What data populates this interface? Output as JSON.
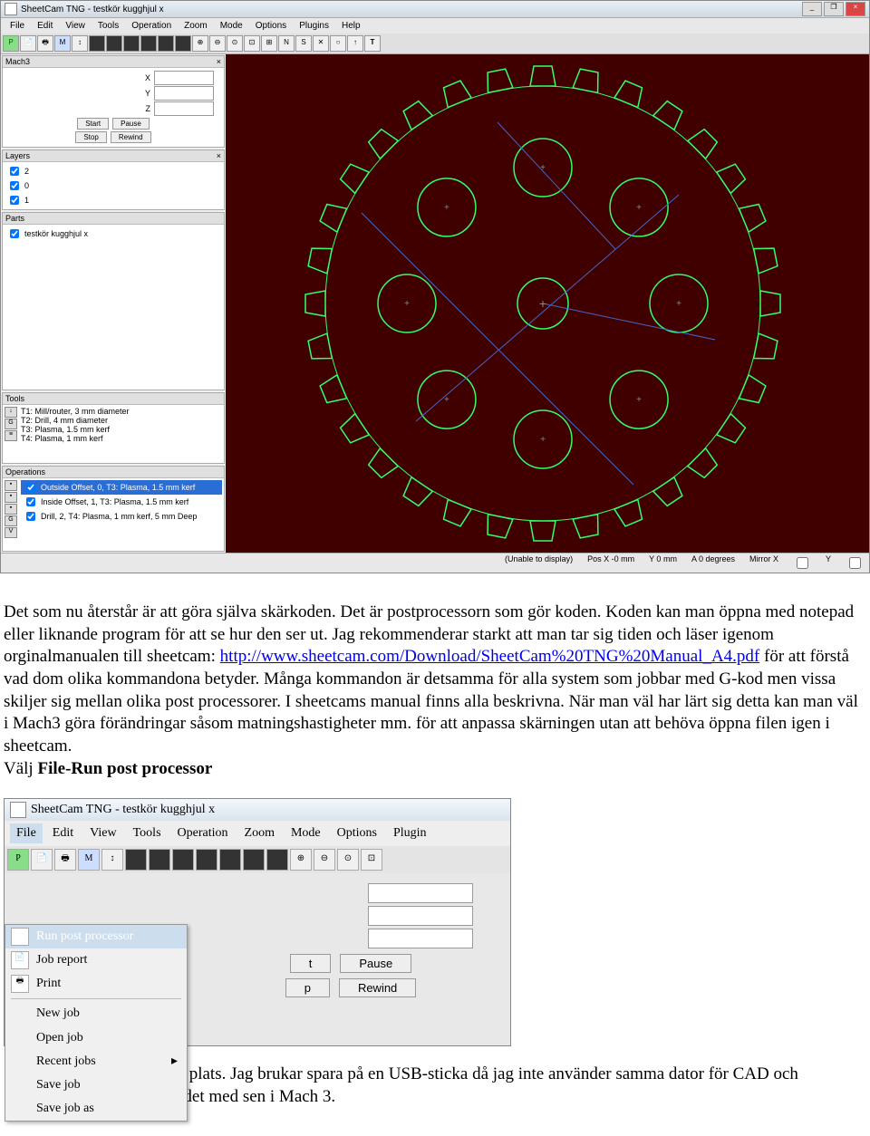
{
  "app": {
    "title": "SheetCam TNG - testkör kugghjul x",
    "menus": [
      "File",
      "Edit",
      "View",
      "Tools",
      "Operation",
      "Zoom",
      "Mode",
      "Options",
      "Plugins",
      "Help"
    ],
    "mach_panel": {
      "title": "Mach3",
      "axes": [
        "X",
        "Y",
        "Z"
      ],
      "buttons": [
        "Start",
        "Pause",
        "Stop",
        "Rewind"
      ]
    },
    "layers": {
      "title": "Layers",
      "close": "×",
      "items": [
        "2",
        "0",
        "1"
      ]
    },
    "parts": {
      "title": "Parts",
      "items": [
        "testkör kugghjul x"
      ]
    },
    "tools": {
      "title": "Tools",
      "items": [
        "T1: Mill/router, 3 mm diameter",
        "T2: Drill, 4 mm diameter",
        "T3: Plasma, 1.5 mm kerf",
        "T4: Plasma, 1 mm kerf"
      ]
    },
    "operations": {
      "title": "Operations",
      "items": [
        "Outside Offset, 0, T3: Plasma, 1.5 mm kerf",
        "Inside Offset, 1, T3: Plasma, 1.5 mm kerf",
        "Drill, 2, T4: Plasma, 1 mm kerf, 5 mm Deep"
      ]
    },
    "status": {
      "unable": "(Unable to display)",
      "posx": "Pos X -0 mm",
      "posy": "Y 0 mm",
      "posa": "A 0 degrees",
      "mirx": "Mirror X",
      "miry": "Y"
    }
  },
  "doc": {
    "p1a": "Det som nu återstår är att göra själva skärkoden. Det är postprocessorn som gör koden. Koden kan man öppna med notepad eller liknande program för att se hur den ser ut. Jag rekommenderar starkt att man tar sig tiden och läser igenom orginalmanualen till sheetcam:",
    "link": "http://www.sheetcam.com/Download/SheetCam%20TNG%20Manual_A4.pdf",
    "p1b": " för att förstå vad dom olika kommandona betyder. Många kommandon är detsamma för alla system som jobbar med G-kod men vissa skiljer sig mellan olika post processorer. I sheetcams manual finns alla beskrivna. När man väl har lärt sig detta kan man väl i Mach3 göra förändringar såsom matningshastigheter mm. för att anpassa skärningen utan att behöva öppna filen igen i sheetcam.",
    "p2a": "Välj ",
    "p2b": "File-Run post processor",
    "p3": "Spara skärfilen på lämplig plats. Jag brukar spara på en USB-sticka då jag inte använder samma dator för CAD och Sheetcam som jag kör bordet med sen i Mach 3."
  },
  "app2": {
    "title": "SheetCam TNG - testkör kugghjul x",
    "menus": [
      "File",
      "Edit",
      "View",
      "Tools",
      "Operation",
      "Zoom",
      "Mode",
      "Options",
      "Plugin"
    ],
    "file_menu": [
      {
        "icon": "P",
        "label": "Run post processor",
        "sel": true
      },
      {
        "icon": "📄",
        "label": "Job report"
      },
      {
        "icon": "🖶",
        "label": "Print"
      },
      {
        "sep": true
      },
      {
        "label": "New job"
      },
      {
        "label": "Open job"
      },
      {
        "label": "Recent jobs",
        "arrow": "▸"
      },
      {
        "label": "Save job"
      },
      {
        "label": "Save job as"
      }
    ],
    "mach_buttons": [
      [
        "t",
        "Pause"
      ],
      [
        "p",
        "Rewind"
      ]
    ]
  }
}
